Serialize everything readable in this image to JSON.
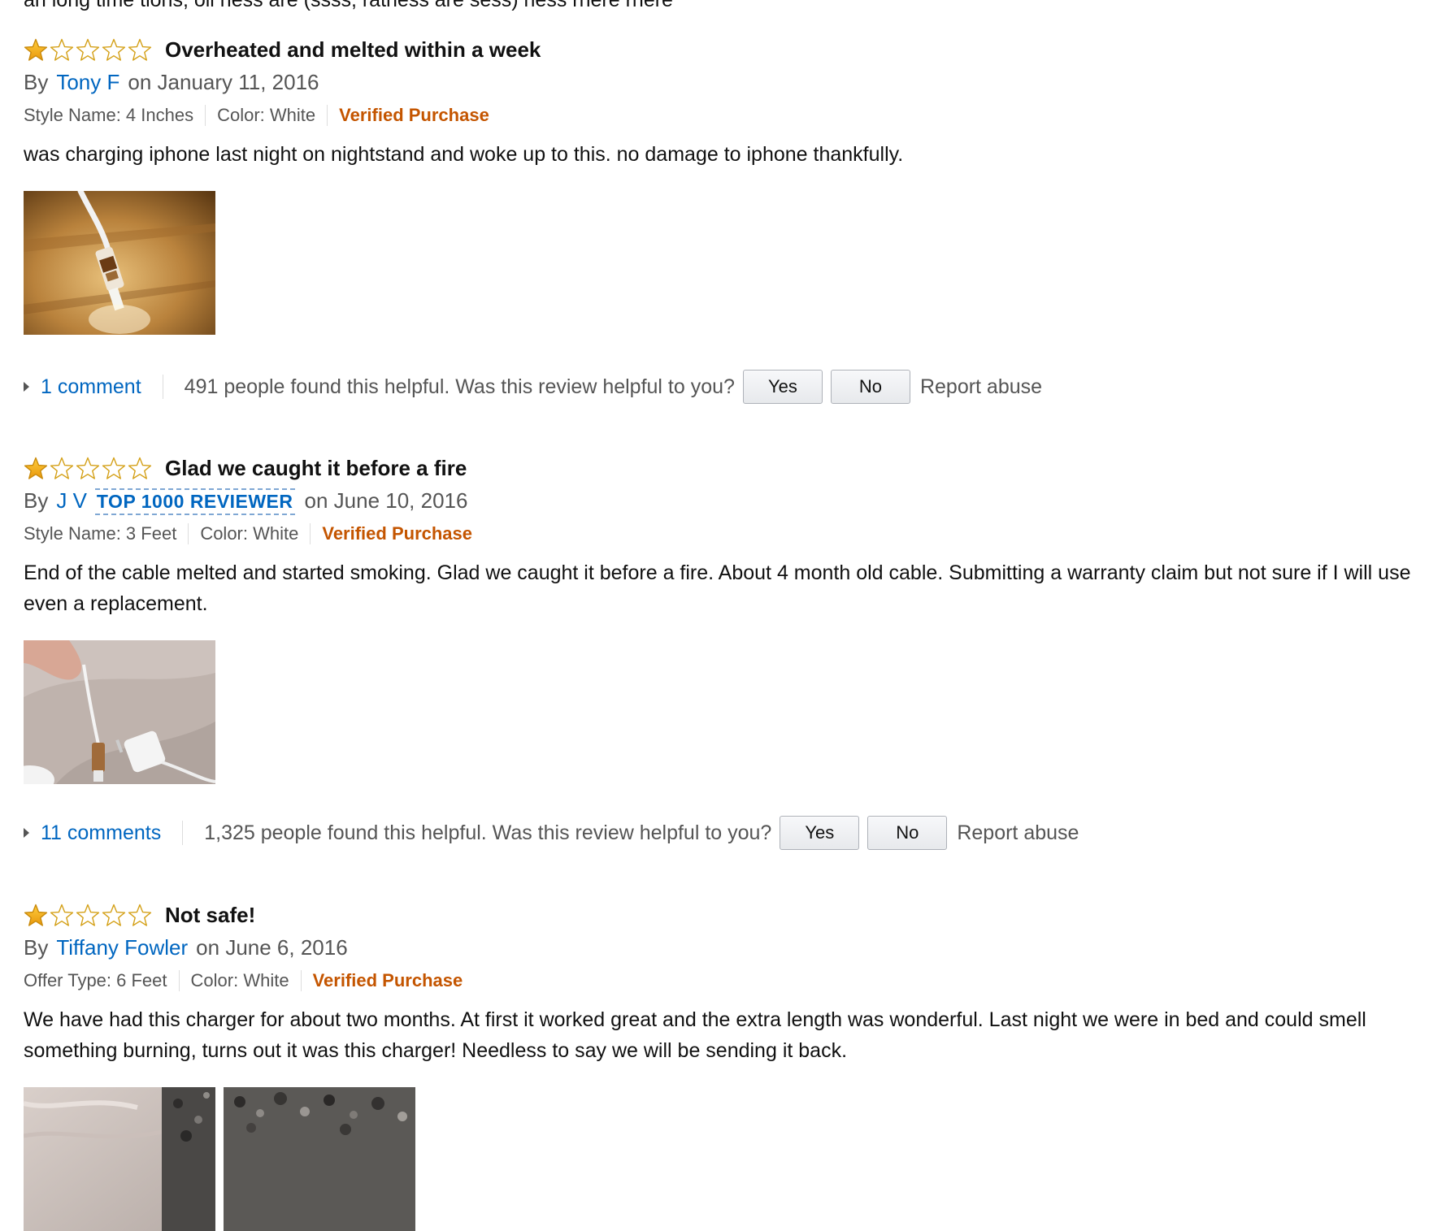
{
  "top_fragment": "an long time tions, oll ness are (ssss, rathess are sess) ness rnere rnere",
  "colors": {
    "link": "#0066c0",
    "verified": "#c45500",
    "star_fill": "#f6a623",
    "star_outline": "#d4a017"
  },
  "reviews": [
    {
      "rating": 1,
      "rating_max": 5,
      "title": "Overheated and melted within a week",
      "by": "By",
      "author": "Tony F",
      "badge": "",
      "date": "on January 11, 2016",
      "style": "Style Name: 4 Inches",
      "color": "Color: White",
      "verified": "Verified Purchase",
      "text": "was charging iphone last night on nightstand and woke up to this. no damage to iphone thankfully.",
      "comments": "1 comment",
      "helpful": "491 people found this helpful. Was this review helpful to you?",
      "yes": "Yes",
      "no": "No",
      "report": "Report abuse"
    },
    {
      "rating": 1,
      "rating_max": 5,
      "title": "Glad we caught it before a fire",
      "by": "By",
      "author": "J V",
      "badge": "TOP 1000 REVIEWER",
      "date": "on June 10, 2016",
      "style": "Style Name: 3 Feet",
      "color": "Color: White",
      "verified": "Verified Purchase",
      "text": "End of the cable melted and started smoking. Glad we caught it before a fire. About 4 month old cable. Submitting a warranty claim but not sure if I will use even a replacement.",
      "comments": "11 comments",
      "helpful": "1,325 people found this helpful. Was this review helpful to you?",
      "yes": "Yes",
      "no": "No",
      "report": "Report abuse"
    },
    {
      "rating": 1,
      "rating_max": 5,
      "title": "Not safe!",
      "by": "By",
      "author": "Tiffany Fowler",
      "badge": "",
      "date": "on June 6, 2016",
      "style": "Offer Type: 6 Feet",
      "color": "Color: White",
      "verified": "Verified Purchase",
      "text": "We have had this charger for about two months. At first it worked great and the extra length was wonderful. Last night we were in bed and could smell something burning, turns out it was this charger! Needless to say we will be sending it back."
    }
  ]
}
